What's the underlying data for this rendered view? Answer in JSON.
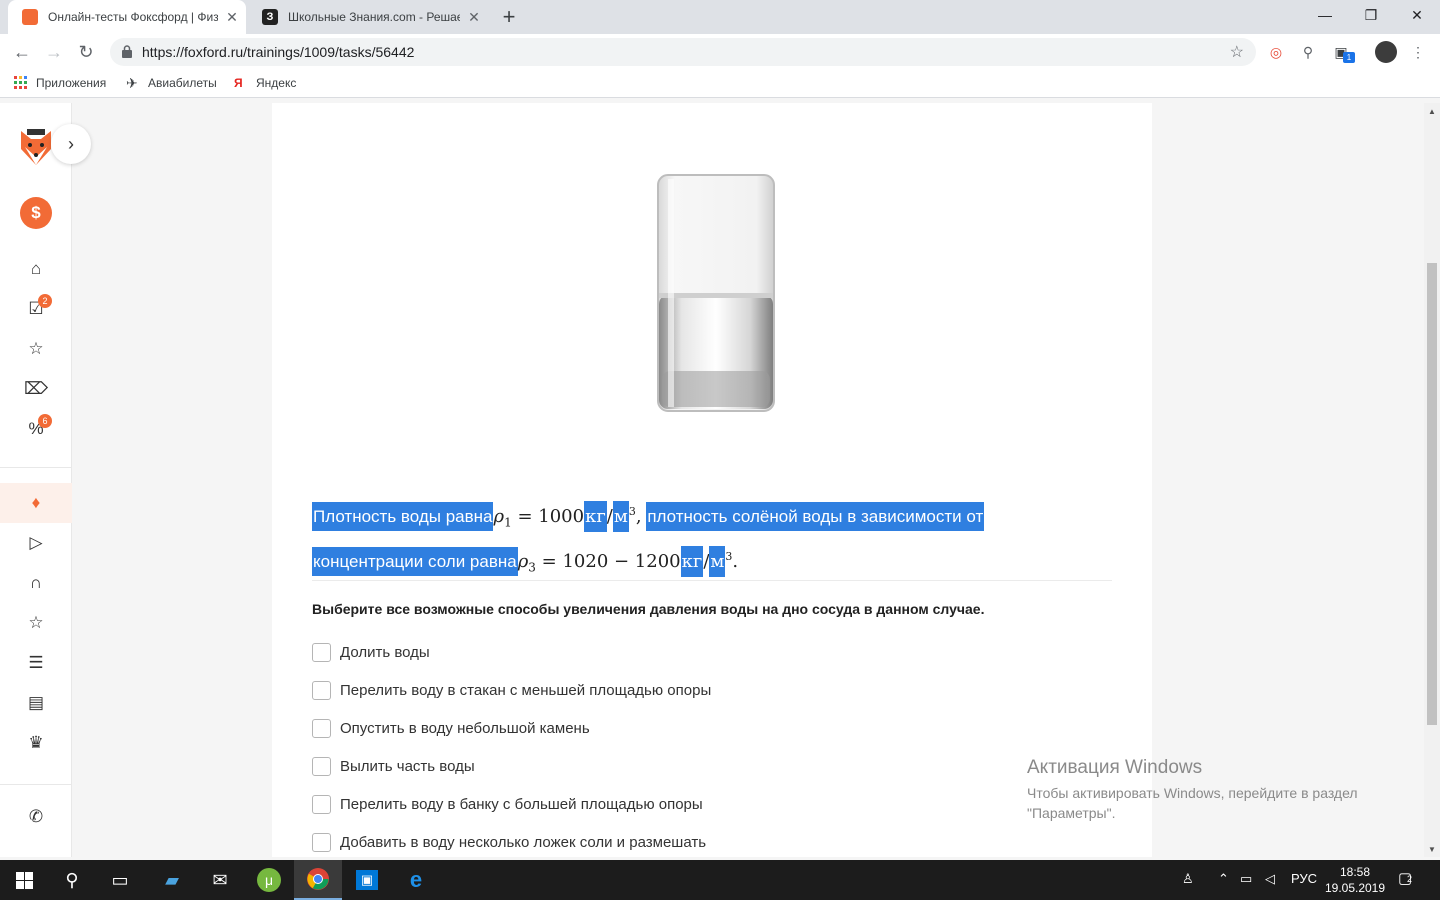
{
  "browser": {
    "tabs": [
      {
        "title": "Онлайн-тесты Фоксфорд | Физи",
        "active": true
      },
      {
        "title": "Школьные Знания.com - Решае",
        "active": false
      }
    ],
    "url": "https://foxford.ru/trainings/1009/tasks/56442",
    "bookmarks": [
      "Приложения",
      "Авиабилеты",
      "Яндекс"
    ],
    "extension_badge": "1"
  },
  "sidebar": {
    "badges": {
      "tasks": "2",
      "discounts": "6"
    }
  },
  "problem": {
    "text_1": "Плотность воды равна",
    "rho1": "ρ",
    "rho1_sub": "1",
    "eq1_value": "= 1000",
    "unit_kg": "кг",
    "slash": "/",
    "unit_m": "м",
    "unit_pow": "3",
    "comma": ",",
    "text_2": "плотность солёной воды в зависимости от",
    "text_3": "концентрации соли равна",
    "rho3": "ρ",
    "rho3_sub": "3",
    "eq2_value": "= 1020 − 1200",
    "period": "."
  },
  "question": "Выберите все возможные способы увеличения давления воды на дно сосуда в данном случае.",
  "options": [
    "Долить воды",
    "Перелить воду в стакан с меньшей площадью опоры",
    "Опустить в воду небольшой камень",
    "Вылить часть воды",
    "Перелить воду в банку с большей площадью опоры",
    "Добавить в воду несколько ложек соли и размешать"
  ],
  "activation": {
    "title": "Активация Windows",
    "line1": "Чтобы активировать Windows, перейдите в раздел",
    "line2": "\"Параметры\"."
  },
  "taskbar": {
    "lang": "РУС",
    "time": "18:58",
    "date": "19.05.2019",
    "notifications": "2"
  },
  "colors": {
    "selection": "#2f7fe0",
    "brand_orange": "#f26b36",
    "taskbar": "#1c1c1c"
  }
}
